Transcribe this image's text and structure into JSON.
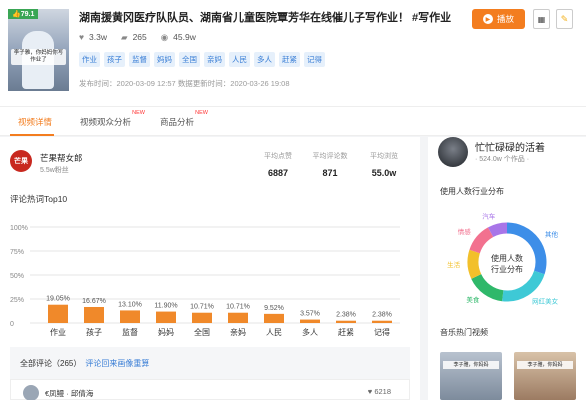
{
  "video": {
    "score": "79.1",
    "thumb_caption": "李子雅，你妈妈你写作业了",
    "title": "湖南援黄冈医疗队队员、湖南省儿童医院覃芳华在线催儿子写作业！ #写作业",
    "likes": "3.3w",
    "comments": "265",
    "views": "45.9w",
    "tags": [
      "作业",
      "孩子",
      "监督",
      "妈妈",
      "全国",
      "亲妈",
      "人民",
      "多人",
      "赶紧",
      "记得"
    ],
    "publish_label": "发布时间：2020-03-09 12:57",
    "update_label": "数据更新时间：2020-03-26 19:08",
    "play_button": "播放",
    "qr_icon": "qr-code-icon",
    "bulb_icon": "lightbulb-icon"
  },
  "tabs": [
    {
      "label": "视频详情",
      "badge": ""
    },
    {
      "label": "视频观众分析",
      "badge": "NEW"
    },
    {
      "label": "商品分析",
      "badge": "NEW"
    }
  ],
  "author": {
    "avatar_text": "芒果帮女郎",
    "name": "芒果帮女郎",
    "fans": "5.5w粉丝"
  },
  "metrics": [
    {
      "label": "平均点赞",
      "value": "6887"
    },
    {
      "label": "平均评论数",
      "value": "871"
    },
    {
      "label": "平均浏览",
      "value": "55.0w"
    }
  ],
  "hot_words_title": "评论热词Top10",
  "chart_data": {
    "type": "bar",
    "categories": [
      "作业",
      "孩子",
      "监督",
      "妈妈",
      "全国",
      "亲妈",
      "人民",
      "多人",
      "赶紧",
      "记得"
    ],
    "values": [
      19.05,
      16.67,
      13.1,
      11.9,
      10.71,
      10.71,
      9.52,
      3.57,
      2.38,
      2.38
    ],
    "value_labels": [
      "19.05%",
      "16.67%",
      "13.10%",
      "11.90%",
      "10.71%",
      "10.71%",
      "9.52%",
      "3.57%",
      "2.38%",
      "2.38%"
    ],
    "yticks": [
      "100%",
      "75%",
      "50%",
      "25%",
      "0"
    ],
    "ylim": [
      0,
      100
    ],
    "bar_color": "#f0892a",
    "grid": true
  },
  "comments_section": {
    "header": "全部评论（265）",
    "link": "评论回来画像重算",
    "first_user": "€凤鳗 · 邱倩海",
    "first_likes": "6218"
  },
  "side": {
    "name": "忙忙碌碌的活着",
    "sub": "· 524.0w 个作品 ·",
    "industry_title": "使用人数行业分布",
    "donut_center": [
      "使用人数",
      "行业分布"
    ],
    "donut_slices": [
      {
        "label": "其他",
        "value": 30,
        "color": "#3d8ee8"
      },
      {
        "label": "网红美女",
        "value": 22,
        "color": "#3ec9d6"
      },
      {
        "label": "美食",
        "value": 16,
        "color": "#2fb86a"
      },
      {
        "label": "生活",
        "value": 12,
        "color": "#f2c02b"
      },
      {
        "label": "情感",
        "value": 12,
        "color": "#f2718f"
      },
      {
        "label": "汽车",
        "value": 8,
        "color": "#a875e8"
      }
    ],
    "music_title": "音乐热门视频",
    "video_captions": [
      "李子雅，你妈妈",
      "李子雅，你妈妈"
    ]
  },
  "colors": {
    "accent": "#f37d1f",
    "link": "#3b7fd6",
    "tag_bg": "#e6f0fb"
  }
}
